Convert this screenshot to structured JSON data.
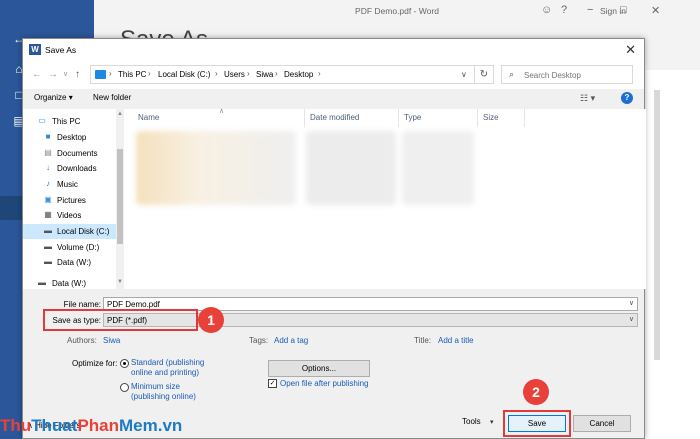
{
  "word": {
    "title": "PDF Demo.pdf  -  Word",
    "sign_in": "Sign in",
    "heading": "Save As"
  },
  "dialog": {
    "title": "Save As",
    "breadcrumbs": [
      "This PC",
      "Local Disk (C:)",
      "Users",
      "Siwa",
      "Desktop"
    ],
    "search_placeholder": "Search Desktop",
    "toolbar": {
      "organize": "Organize",
      "new_folder": "New folder"
    },
    "nav_items": [
      {
        "label": "This PC",
        "icon": "computer-icon"
      },
      {
        "label": "Desktop",
        "icon": "desktop-folder-icon"
      },
      {
        "label": "Documents",
        "icon": "documents-folder-icon"
      },
      {
        "label": "Downloads",
        "icon": "downloads-folder-icon"
      },
      {
        "label": "Music",
        "icon": "music-folder-icon"
      },
      {
        "label": "Pictures",
        "icon": "pictures-folder-icon"
      },
      {
        "label": "Videos",
        "icon": "videos-folder-icon"
      },
      {
        "label": "Local Disk (C:)",
        "icon": "drive-icon",
        "selected": true
      },
      {
        "label": "Volume (D:)",
        "icon": "drive-icon"
      },
      {
        "label": "Data (W:)",
        "icon": "drive-icon"
      },
      {
        "label": "Data (W:)",
        "icon": "network-drive-icon"
      }
    ],
    "columns": [
      "Name",
      "Date modified",
      "Type",
      "Size"
    ],
    "file_name_label": "File name:",
    "file_name_value": "PDF Demo.pdf",
    "save_as_type_label": "Save as type:",
    "save_as_type_value": "PDF (*.pdf)",
    "authors_label": "Authors:",
    "authors_value": "Siwa",
    "tags_label": "Tags:",
    "tags_value": "Add a tag",
    "title_label": "Title:",
    "title_value": "Add a title",
    "optimize_label": "Optimize for:",
    "optimize_standard_line1": "Standard (publishing",
    "optimize_standard_line2": "online and printing)",
    "optimize_minimum_line1": "Minimum size",
    "optimize_minimum_line2": "(publishing online)",
    "options_button": "Options...",
    "open_after_publish": "Open file after publishing",
    "hide_folders": "Hide Folders",
    "tools": "Tools",
    "save": "Save",
    "cancel": "Cancel"
  },
  "annotations": {
    "badge1": "1",
    "badge2": "2",
    "highlight_color": "#e03a3a"
  },
  "watermark": {
    "p1": "Thu",
    "p2": "Thuat",
    "p3": "Phan",
    "p4": "Mem.vn"
  },
  "colors": {
    "word_blue": "#2b579a",
    "link_blue": "#1a5bb5",
    "selection": "#cce8ff"
  }
}
